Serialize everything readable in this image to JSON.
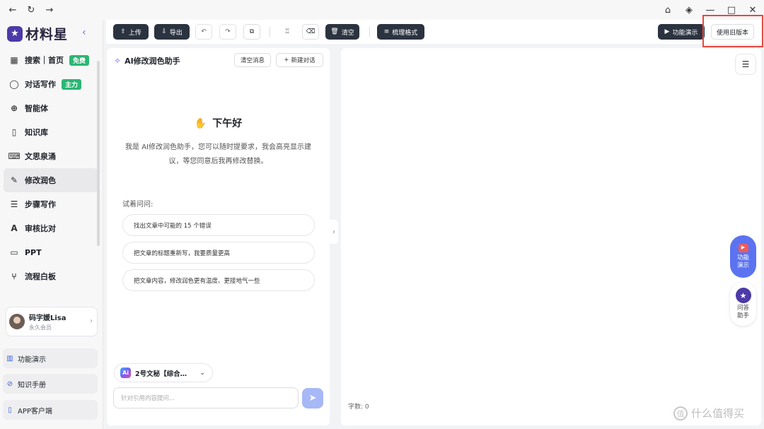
{
  "window": {
    "nav_back": "←",
    "nav_refresh": "↻",
    "nav_forward": "→",
    "controls": [
      "⌂",
      "◈",
      "—",
      "□",
      "✕"
    ]
  },
  "brand": {
    "name": "材料星",
    "collapse_icon": "chevron-left-icon"
  },
  "sidebar": {
    "items": [
      {
        "label": "搜索｜首页",
        "icon": "grid-icon",
        "badge": "免费"
      },
      {
        "label": "对话写作",
        "icon": "chat-icon",
        "badge": "主力"
      },
      {
        "label": "智能体",
        "icon": "globe-icon"
      },
      {
        "label": "知识库",
        "icon": "book-icon"
      },
      {
        "label": "文思泉涌",
        "icon": "keyboard-icon"
      },
      {
        "label": "修改润色",
        "icon": "pen-icon",
        "active": true
      },
      {
        "label": "步骤写作",
        "icon": "list-icon"
      },
      {
        "label": "审核比对",
        "icon": "check-icon"
      },
      {
        "label": "PPT",
        "icon": "presentation-icon"
      },
      {
        "label": "流程白板",
        "icon": "flow-icon"
      }
    ],
    "user": {
      "name": "码字媛Lisa",
      "level": "永久会员"
    },
    "bottom_links": [
      {
        "label": "功能演示",
        "icon": "book-open-icon"
      },
      {
        "label": "知识手册",
        "icon": "compass-icon"
      },
      {
        "label": "APP客户端",
        "icon": "phone-icon"
      }
    ]
  },
  "toolbar": {
    "upload": "上传",
    "export": "导出",
    "clear": "清空",
    "format": "梳理格式",
    "demo": "功能演示",
    "old_version": "使用旧版本"
  },
  "chat": {
    "title": "AI修改润色助手",
    "clear_messages": "清空消息",
    "new_chat": "新建对话",
    "greeting": "下午好",
    "intro": "我是 AI修改润色助手，您可以随时提要求，我会高亮显示建议，等您同意后我再修改替换。",
    "try_label": "试着问问:",
    "suggestions": [
      "找出文章中可能的 15 个错误",
      "把文章的标题重新写，我要质量更高",
      "把文章内容，修改润色更有温度、更接地气一些"
    ],
    "model": "2号文秘【综合…",
    "input_placeholder": "针对引用内容提问..."
  },
  "editor": {
    "word_count": "字数: 0"
  },
  "floating": {
    "demo": "功能演示",
    "help": "问答助手"
  },
  "watermark": "什么值得买",
  "colors": {
    "dark_button": "#2c3340",
    "accent": "#5b73f0",
    "badge_green": "#2bb673",
    "highlight_red": "#e8473e"
  }
}
